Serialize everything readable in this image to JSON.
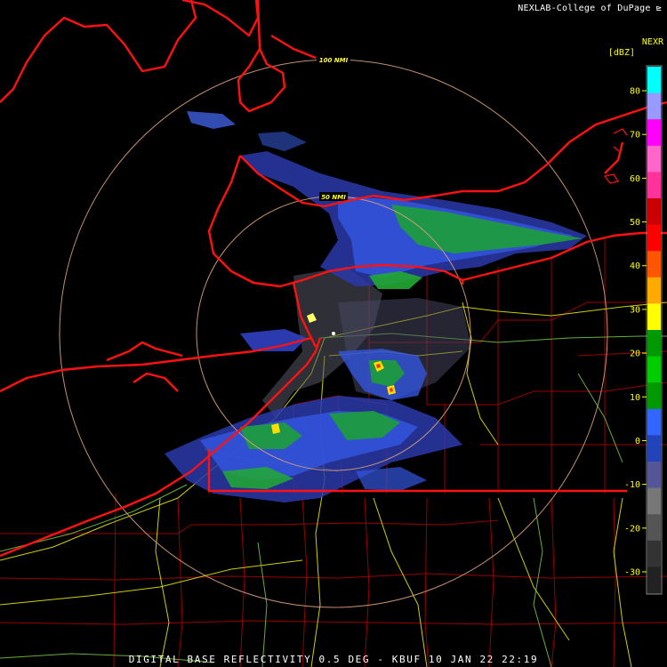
{
  "header": {
    "credit": "NEXLAB-College of DuPage"
  },
  "footer": {
    "caption": "DIGITAL BASE REFLECTIVITY 0.5 DEG - KBUF 10 JAN 22 22:19"
  },
  "range_rings": [
    {
      "label": "100 NMI",
      "radius_nmi": 100
    },
    {
      "label": "50 NMI",
      "radius_nmi": 50
    }
  ],
  "legend": {
    "product": "NEXR",
    "unit": "[dBZ]",
    "ticks": [
      "80",
      "70",
      "60",
      "50",
      "40",
      "30",
      "20",
      "10",
      "0",
      "-10",
      "-20",
      "-30"
    ],
    "colors": [
      "#00ffff",
      "#9999ff",
      "#ff00ff",
      "#ff66cc",
      "#ff3399",
      "#cc0000",
      "#ff0000",
      "#ff5500",
      "#ffaa00",
      "#ffff00",
      "#009900",
      "#00cc00",
      "#009900",
      "#3366ff",
      "#2244bb",
      "#555599",
      "#777777",
      "#555555",
      "#333333",
      "#222222"
    ]
  },
  "colors": {
    "state_border": "#ff0000",
    "county_line": "#cc0000",
    "highway": "#e6e600",
    "interstate_alt": "#77cc44",
    "range_ring": "#d9a07a"
  }
}
